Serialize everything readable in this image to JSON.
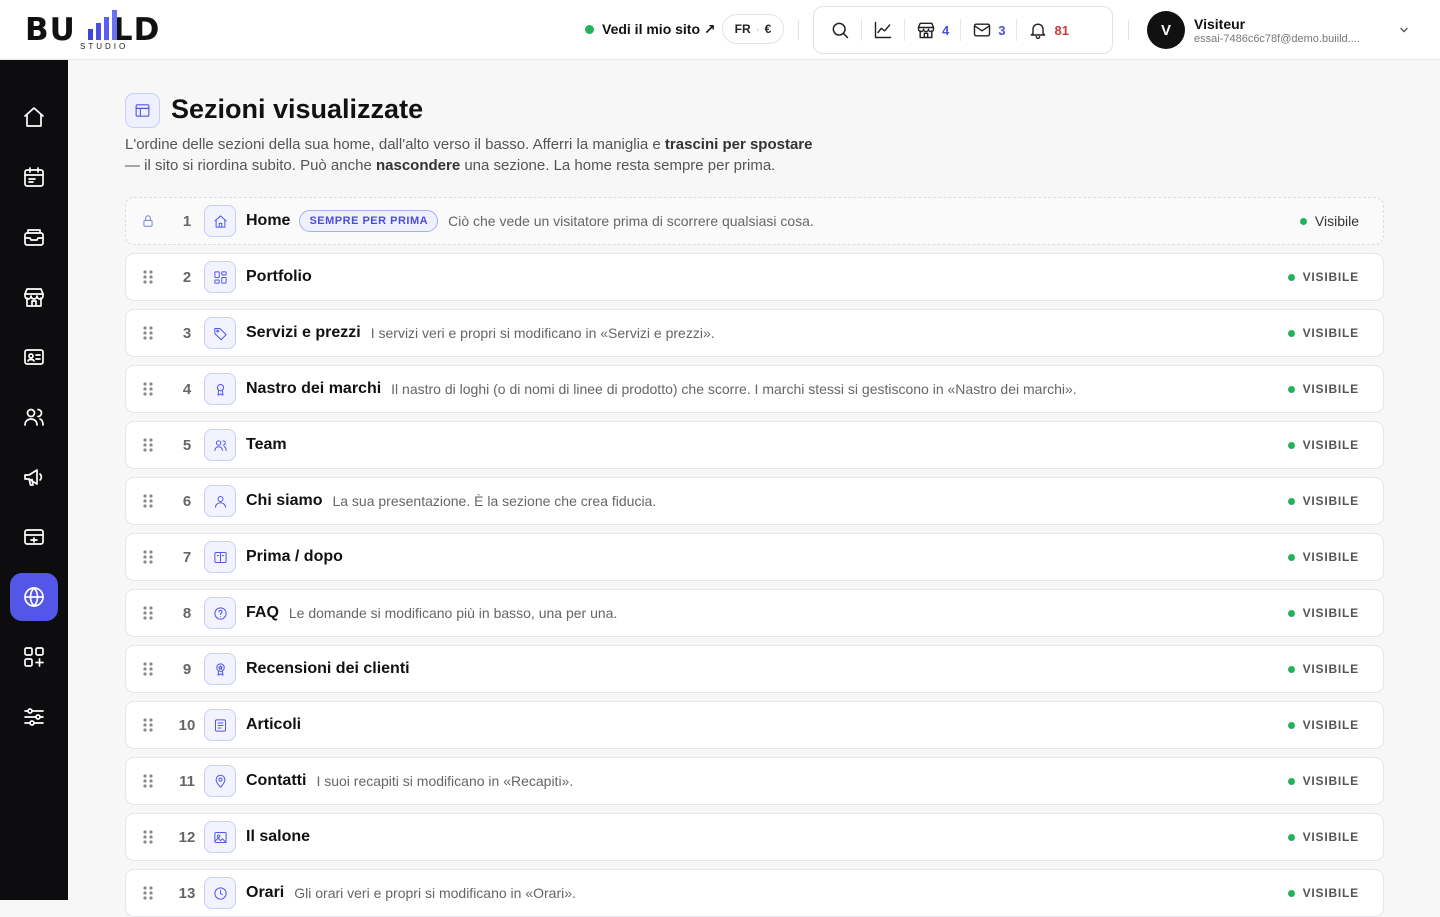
{
  "brand": {
    "logo_left": "BU",
    "logo_right": "LD",
    "logo_sub": "STUDIO"
  },
  "header": {
    "site_link": "Vedi il mio sito ↗",
    "lang": "FR",
    "currency": "€",
    "counts": {
      "shop": "4",
      "mail": "3",
      "notifications": "81"
    },
    "colors": {
      "shop_count": "#4a4fd8",
      "mail_count": "#4a4fd8",
      "notifications_count": "#d23a3a"
    },
    "user": {
      "initial": "V",
      "name": "Visiteur",
      "email": "essai-7486c6c78f@demo.buiild...."
    }
  },
  "sidebar": {
    "items": [
      {
        "icon": "home-icon"
      },
      {
        "icon": "calendar-icon"
      },
      {
        "icon": "inbox-tray-icon"
      },
      {
        "icon": "store-icon"
      },
      {
        "icon": "contact-card-icon"
      },
      {
        "icon": "users-icon"
      },
      {
        "icon": "megaphone-icon"
      },
      {
        "icon": "payment-card-icon"
      },
      {
        "icon": "globe-icon",
        "active": true
      },
      {
        "icon": "apps-add-icon"
      },
      {
        "icon": "sliders-icon"
      }
    ]
  },
  "page": {
    "title": "Sezioni visualizzate",
    "desc_1": "L'ordine delle sezioni della sua home, dall'alto verso il basso. Afferri la maniglia e ",
    "desc_bold_1": "trascini per spostare",
    "desc_2": " — il sito si riordina subito. Può anche ",
    "desc_bold_2": "nascondere",
    "desc_3": " una sezione. La home resta sempre per prima."
  },
  "sections": [
    {
      "num": "1",
      "name": "Home",
      "badge": "SEMPRE PER PRIMA",
      "desc": "Ciò che vede un visitatore prima di scorrere qualsiasi cosa.",
      "status": "Visibile",
      "icon": "home-icon",
      "locked": true
    },
    {
      "num": "2",
      "name": "Portfolio",
      "desc": "",
      "status": "VISIBILE",
      "icon": "grid-icon"
    },
    {
      "num": "3",
      "name": "Servizi e prezzi",
      "desc": "I servizi veri e propri si modificano in «Servizi e prezzi».",
      "status": "VISIBILE",
      "icon": "tag-icon"
    },
    {
      "num": "4",
      "name": "Nastro dei marchi",
      "desc": "Il nastro di loghi (o di nomi di linee di prodotto) che scorre. I marchi stessi si gestiscono in «Nastro dei marchi».",
      "status": "VISIBILE",
      "icon": "award-icon"
    },
    {
      "num": "5",
      "name": "Team",
      "desc": "",
      "status": "VISIBILE",
      "icon": "team-icon"
    },
    {
      "num": "6",
      "name": "Chi siamo",
      "desc": "La sua presentazione. È la sezione che crea fiducia.",
      "status": "VISIBILE",
      "icon": "person-icon"
    },
    {
      "num": "7",
      "name": "Prima / dopo",
      "desc": "",
      "status": "VISIBILE",
      "icon": "compare-icon"
    },
    {
      "num": "8",
      "name": "FAQ",
      "desc": "Le domande si modificano più in basso, una per una.",
      "status": "VISIBILE",
      "icon": "question-icon"
    },
    {
      "num": "9",
      "name": "Recensioni dei clienti",
      "desc": "",
      "status": "VISIBILE",
      "icon": "review-badge-icon"
    },
    {
      "num": "10",
      "name": "Articoli",
      "desc": "",
      "status": "VISIBILE",
      "icon": "article-icon"
    },
    {
      "num": "11",
      "name": "Contatti",
      "desc": "I suoi recapiti si modificano in «Recapiti».",
      "status": "VISIBILE",
      "icon": "map-pin-icon"
    },
    {
      "num": "12",
      "name": "Il salone",
      "desc": "",
      "status": "VISIBILE",
      "icon": "image-icon"
    },
    {
      "num": "13",
      "name": "Orari",
      "desc": "Gli orari veri e propri si modificano in «Orari».",
      "status": "VISIBILE",
      "icon": "clock-icon"
    }
  ]
}
